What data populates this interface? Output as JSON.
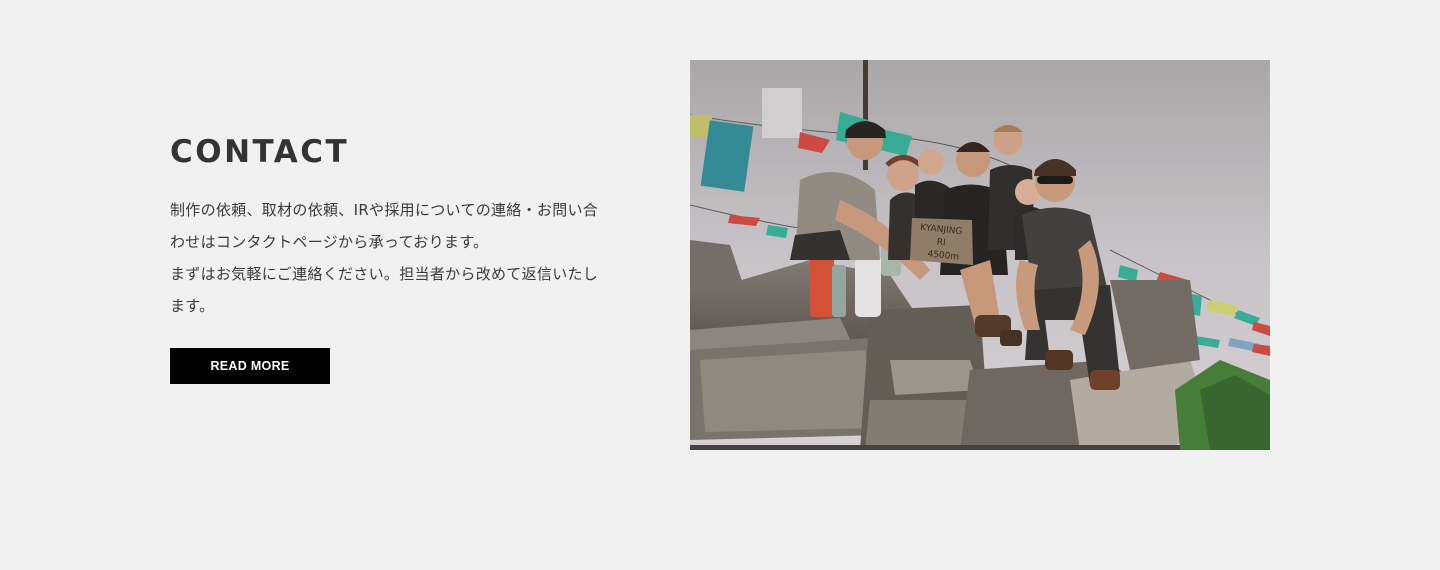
{
  "contact": {
    "title": "CONTACT",
    "paragraph_1": "制作の依頼、取材の依頼、IRや採用についての連絡・お問い合わせはコンタクトページから承っております。",
    "paragraph_2": "まずはお気軽にご連絡ください。担当者から改めて返信いたします。",
    "button_label": "READ MORE",
    "photo": {
      "subject": "group-of-hikers-photo",
      "sign_text": "KYANJING RI 4500m"
    }
  },
  "colors": {
    "background": "#f1f1f1",
    "title": "#333333",
    "button_bg": "#000000",
    "button_text": "#ffffff"
  }
}
